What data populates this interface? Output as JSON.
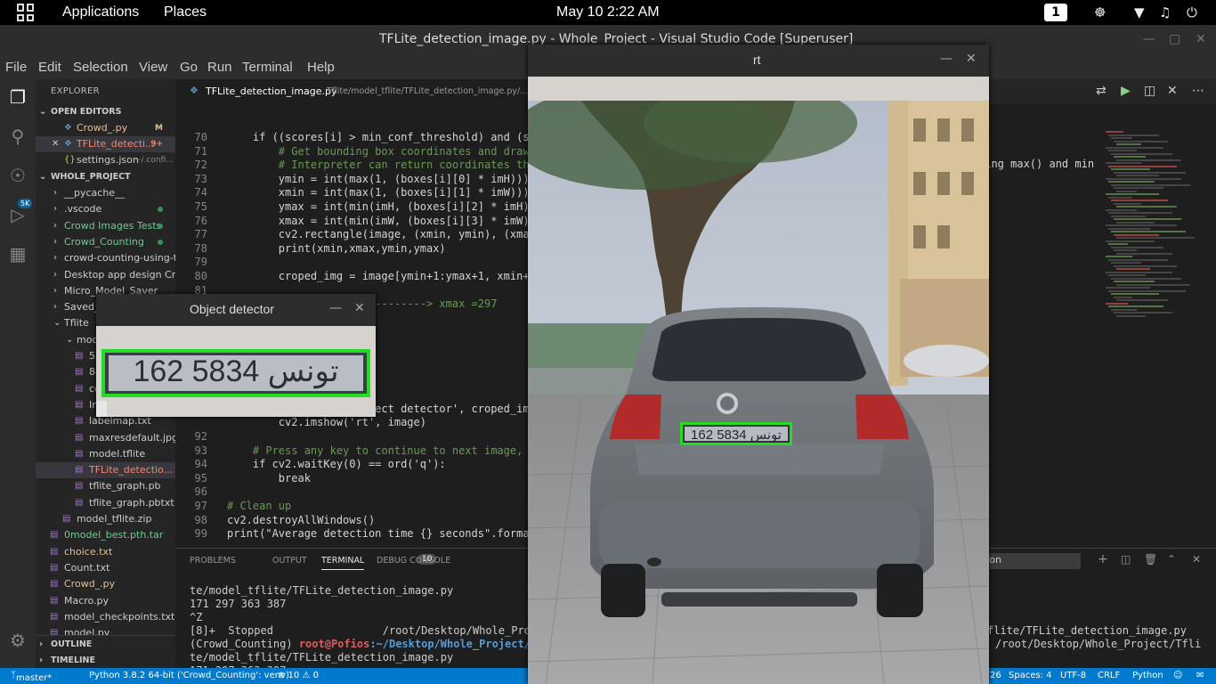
{
  "topbar": {
    "applications": "Applications",
    "places": "Places",
    "datetime": "May 10   2:22 AM",
    "workspace": "1"
  },
  "vscode": {
    "title": "TFLite_detection_image.py - Whole_Project - Visual Studio Code [Superuser]",
    "menu": [
      "File",
      "Edit",
      "Selection",
      "View",
      "Go",
      "Run",
      "Terminal",
      "Help"
    ],
    "activity_badge": "5K"
  },
  "sidebar": {
    "header": "EXPLORER",
    "open_editors": "OPEN EDITORS",
    "open_files": [
      {
        "name": "Crowd_.py",
        "status": "M"
      },
      {
        "name": "TFLite_detecti...",
        "status": "9+"
      },
      {
        "name": "settings.json",
        "path": "~/.confi..."
      }
    ],
    "project": "WHOLE_PROJECT",
    "tree": [
      "__pycache__",
      ".vscode",
      "Crowd Images Tests",
      "Crowd_Counting",
      "crowd-counting-using-te...",
      "Desktop app design Crow",
      "Micro_Model_Saver",
      "Saved_M",
      "Tflite",
      "model_",
      "52.jpe",
      "849.jp",
      "cd5jp",
      "Image",
      "labelmap.txt",
      "maxresdefault.jpg",
      "model.tflite",
      "TFLite_detectio...",
      "tflite_graph.pb",
      "tflite_graph.pbtxt",
      "model_tflite.zip",
      "0model_best.pth.tar",
      "choice.txt",
      "Count.txt",
      "Crowd_.py",
      "Macro.py",
      "model_checkpoints.txt",
      "model.py"
    ],
    "tree_status": {
      "0model_best.pth.tar": "U",
      "choice.txt": "M",
      "Crowd_.py": "M",
      "TFLite_detectio...": "9+"
    },
    "outline": "OUTLINE",
    "timeline": "TIMELINE"
  },
  "editor": {
    "tab_title": "TFLite_detection_image.py",
    "tab_path": "Tflite/model_tflite/TFLite_detection_image.py/...",
    "lines": [
      {
        "n": "70",
        "code": "    if ((scores[i] > min_conf_threshold) and (sc"
      },
      {
        "n": "71",
        "code": "        # Get bounding box coordinates and draw"
      },
      {
        "n": "72",
        "code": "        # Interpreter can return coordinates tha"
      },
      {
        "n": "73",
        "code": "        ymin = int(max(1, (boxes[i][0] * imH)))"
      },
      {
        "n": "74",
        "code": "        xmin = int(max(1, (boxes[i][1] * imW)))"
      },
      {
        "n": "75",
        "code": "        ymax = int(min(imH, (boxes[i][2] * imH))"
      },
      {
        "n": "76",
        "code": "        xmax = int(min(imW, (boxes[i][3] * imW))"
      },
      {
        "n": "77",
        "code": "        cv2.rectangle(image, (xmin, ymin), (xmax"
      },
      {
        "n": "78",
        "code": "        print(xmin,xmax,ymin,ymax)"
      },
      {
        "n": "79",
        "code": ""
      },
      {
        "n": "80",
        "code": "        croped_img = image[ymin+1:ymax+1, xmin+1"
      },
      {
        "n": "81",
        "code": ""
      },
      {
        "n": "82",
        "code": "        #xmin = 171 -----------> xmax =297"
      },
      {
        "n": "91",
        "code": "        cv2.imshow('Object detector', croped_img)"
      },
      {
        "n": "",
        "code": "        cv2.imshow('rt', image)"
      },
      {
        "n": "92",
        "code": ""
      },
      {
        "n": "93",
        "code": "    # Press any key to continue to next image, o"
      },
      {
        "n": "94",
        "code": "    if cv2.waitKey(0) == ord('q'):"
      },
      {
        "n": "95",
        "code": "        break"
      },
      {
        "n": "96",
        "code": ""
      },
      {
        "n": "97",
        "code": "# Clean up"
      },
      {
        "n": "98",
        "code": "cv2.destroyAllWindows()"
      },
      {
        "n": "99",
        "code": "print(\"Average detection time {} seconds\".format"
      }
    ],
    "overflow_text": "sing max() and min"
  },
  "panel": {
    "tabs": [
      "PROBLEMS",
      "OUTPUT",
      "TERMINAL",
      "DEBUG CONSOLE"
    ],
    "problems_count": "10",
    "terminal_select": "thon",
    "terminal_lines": [
      "te/model_tflite/TFLite_detection_image.py",
      "171 297 363 387",
      "^Z",
      "[8]+  Stopped                 /root/Desktop/Whole_Proj",
      "te/model_tflite/TFLite_detection_image.py",
      "171 297 363 387"
    ],
    "prompt_env": "(Crowd_Counting) ",
    "prompt_user": "root@Pofios",
    "prompt_path": ":~/Desktop/Whole_Project/T",
    "right_line1": "flite/TFLite_detection_image.py",
    "right_line2": "/root/Desktop/Whole_Project/Tfli"
  },
  "status": {
    "branch": "master*",
    "python": "Python 3.8.2 64-bit ('Crowd_Counting': venv)",
    "problems": "⊗ 10 ⚠ 0",
    "col": "26",
    "spaces": "Spaces: 4",
    "encoding": "UTF-8",
    "eol": "CRLF",
    "language": "Python"
  },
  "rt_window": {
    "title": "rt",
    "plate_text": "162 تونس 5834"
  },
  "od_window": {
    "title": "Object detector",
    "plate_text": "162 تونس 5834"
  },
  "colors": {
    "status_bar": "#007acc",
    "detection_box": "#22dd22",
    "accent_green": "#3c8f5a"
  }
}
